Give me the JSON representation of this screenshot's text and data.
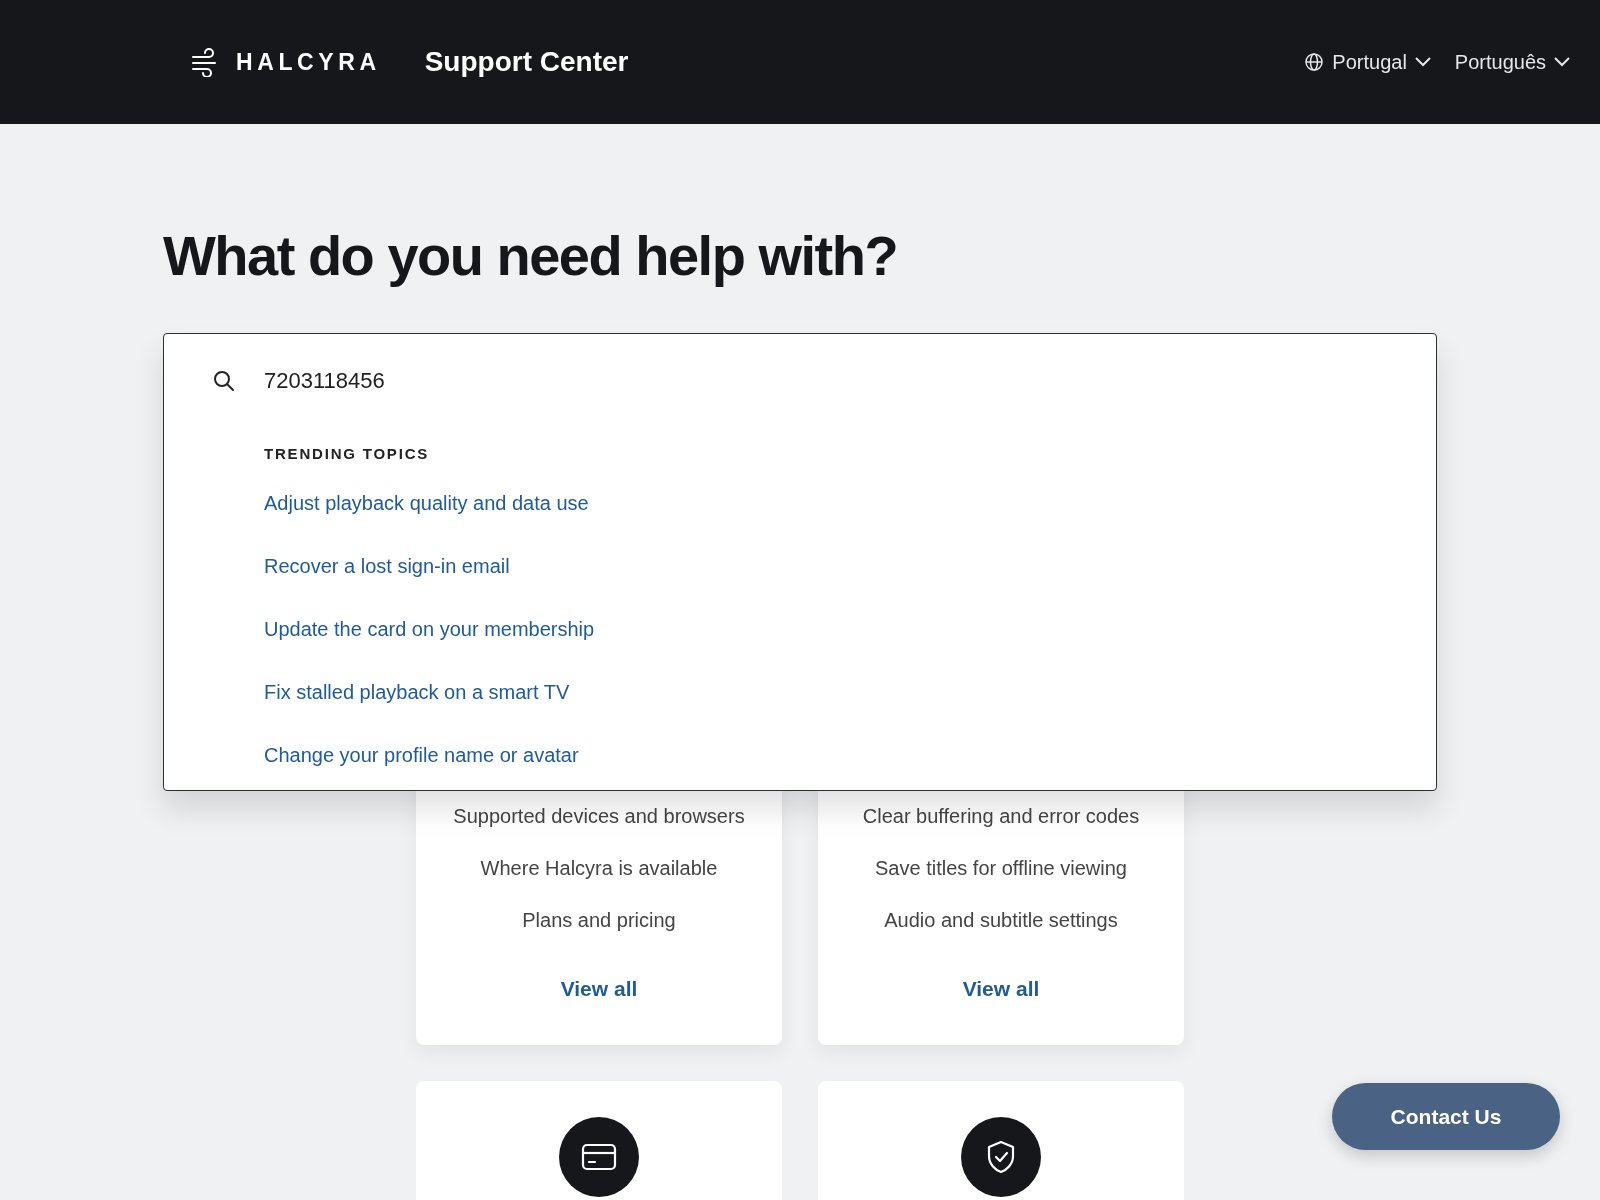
{
  "header": {
    "brand": "HALCYRA",
    "title": "Support Center",
    "region": "Portugal",
    "language": "Português"
  },
  "heading": "What do you need help with?",
  "search": {
    "value": "7203118456",
    "section_title": "TRENDING TOPICS",
    "suggestions": [
      "Adjust playback quality and data use",
      "Recover a lost sign-in email",
      "Update the card on your membership",
      "Fix stalled playback on a smart TV",
      "Change your profile name or avatar"
    ]
  },
  "topic_cards": [
    {
      "links": [
        "Supported devices and browsers",
        "Where Halcyra is available",
        "Plans and pricing"
      ],
      "view_all": "View all"
    },
    {
      "links": [
        "Clear buffering and error codes",
        "Save titles for offline viewing",
        "Audio and subtitle settings"
      ],
      "view_all": "View all"
    }
  ],
  "icon_cards": [
    {
      "kind": "card"
    },
    {
      "kind": "shield"
    }
  ],
  "contact_button": "Contact Us"
}
